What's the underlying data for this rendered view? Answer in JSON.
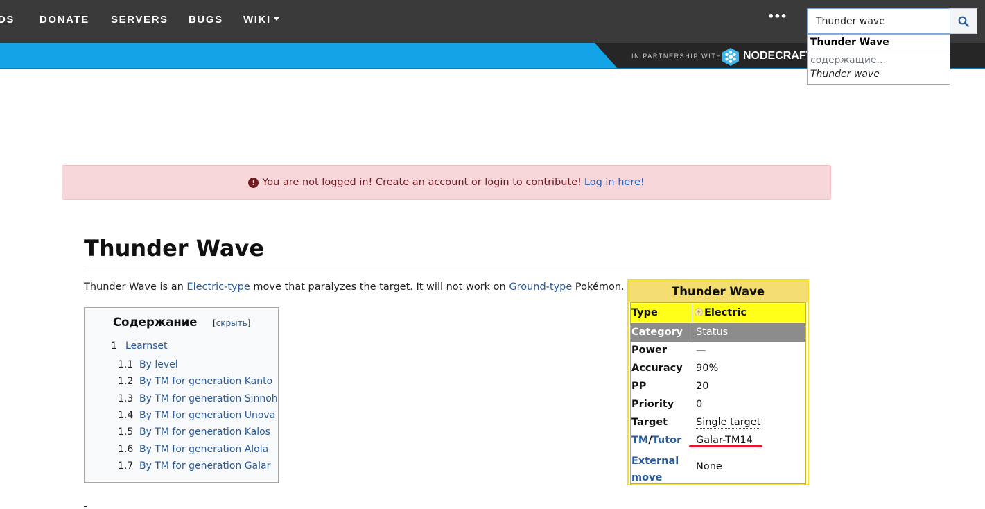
{
  "nav": {
    "items": [
      "DS",
      "DONATE",
      "SERVERS",
      "BUGS",
      "WIKI"
    ],
    "more": "•••",
    "search_value": "Thunder wave"
  },
  "search_suggest": {
    "main": "Thunder Wave",
    "containing": "содержащие...",
    "term": "Thunder wave"
  },
  "banner": {
    "partner_text": "IN PARTNERSHIP WITH",
    "partner_name": "NODECRAFT"
  },
  "alert": {
    "message": "You are not logged in! Create an account or login to contribute!",
    "link": "Log in here!"
  },
  "article": {
    "title": "Thunder Wave",
    "intro": {
      "part1": "Thunder Wave is an ",
      "link1": "Electric-type",
      "part2": " move that paralyzes the target. It will not work on ",
      "link2": "Ground-type",
      "part3": " Pokémon."
    }
  },
  "toc": {
    "title": "Содержание",
    "toggle_open": "[",
    "toggle": "скрыть",
    "toggle_close": "]",
    "items": [
      {
        "num": "1",
        "label": "Learnset"
      },
      {
        "num": "1.1",
        "label": "By level"
      },
      {
        "num": "1.2",
        "label": "By TM for generation Kanto"
      },
      {
        "num": "1.3",
        "label": "By TM for generation Sinnoh"
      },
      {
        "num": "1.4",
        "label": "By TM for generation Unova"
      },
      {
        "num": "1.5",
        "label": "By TM for generation Kalos"
      },
      {
        "num": "1.6",
        "label": "By TM for generation Alola"
      },
      {
        "num": "1.7",
        "label": "By TM for generation Galar"
      }
    ]
  },
  "infobox": {
    "title": "Thunder Wave",
    "type_label": "Type",
    "type_value": "Electric",
    "category_label": "Category",
    "category_value": "Status",
    "power_label": "Power",
    "power_value": "—",
    "accuracy_label": "Accuracy",
    "accuracy_value": "90%",
    "pp_label": "PP",
    "pp_value": "20",
    "priority_label": "Priority",
    "priority_value": "0",
    "target_label": "Target",
    "target_value": "Single target",
    "tm_label_a": "TM",
    "tm_label_sep": "/",
    "tm_label_b": "Tutor",
    "tm_value": "Galar-TM14",
    "external_label_1": "External",
    "external_label_2": "move",
    "external_value": "None"
  },
  "colors": {
    "nav_bg": "#3a3a3a",
    "banner_blue": "#12a4e6",
    "alert_bg": "#f8d7da",
    "infobox_type": "#ffff1a",
    "infobox_category": "#8c8c8c",
    "highlight_red": "#e8122a"
  }
}
